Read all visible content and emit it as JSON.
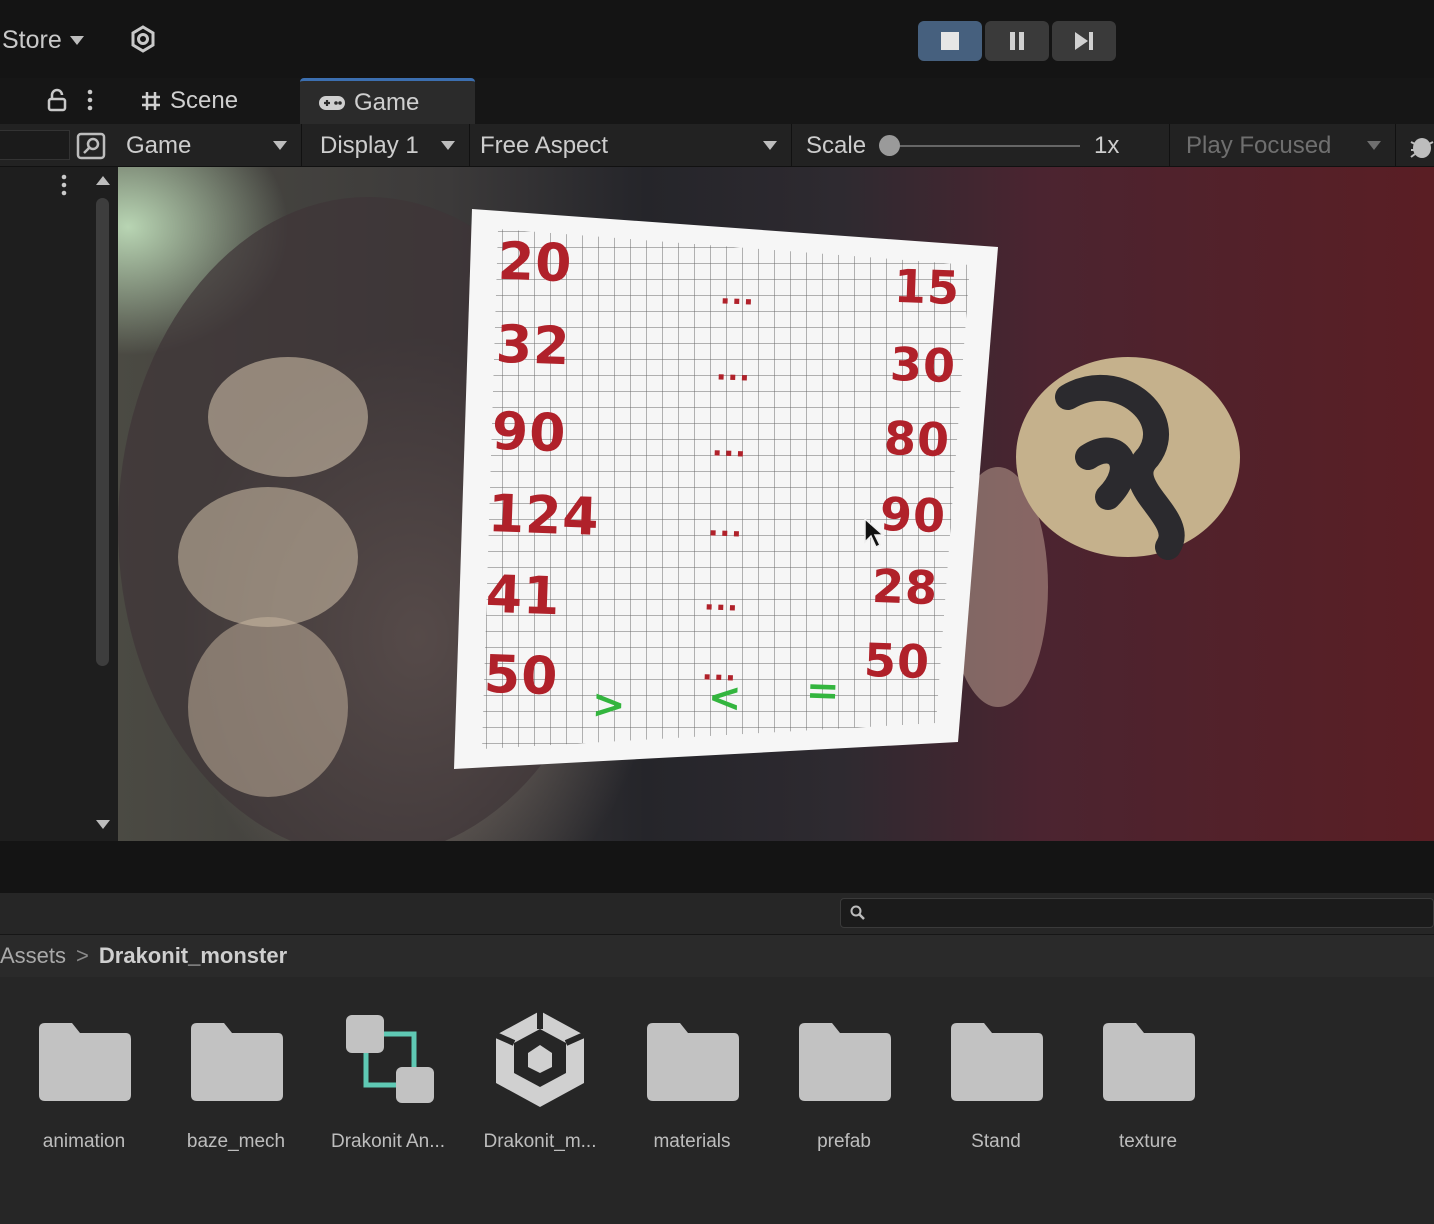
{
  "toolbar": {
    "store_label": "Store",
    "icons": [
      "settings-gear-icon",
      "stop-icon",
      "pause-icon",
      "step-icon"
    ],
    "play_active_color": "#46607e"
  },
  "tabs": [
    {
      "label": "Scene",
      "icon": "grid-hash-icon"
    },
    {
      "label": "Game",
      "icon": "gamepad-icon",
      "active": true
    }
  ],
  "game_toolbar": {
    "mode": "Game",
    "display": "Display 1",
    "aspect": "Free Aspect",
    "scale_label": "Scale",
    "scale_value": "1x",
    "play_mode": "Play Focused"
  },
  "card": {
    "left_numbers": [
      "20",
      "32",
      "90",
      "124",
      "41",
      "50"
    ],
    "dots": [
      "...",
      "...",
      "...",
      "...",
      "...",
      "..."
    ],
    "right_numbers": [
      "15",
      "30",
      "80",
      "90",
      "28",
      "50"
    ],
    "symbols": [
      ">",
      "<",
      "="
    ],
    "number_color": "#b0212a",
    "symbol_color": "#33b53e"
  },
  "breadcrumb": {
    "root": "Assets",
    "separator": ">",
    "current": "Drakonit_monster"
  },
  "assets": [
    {
      "label": "animation",
      "icon": "folder-icon"
    },
    {
      "label": "baze_mech",
      "icon": "folder-icon"
    },
    {
      "label": "Drakonit An...",
      "icon": "animator-controller-icon"
    },
    {
      "label": "Drakonit_m...",
      "icon": "prefab-cube-icon"
    },
    {
      "label": "materials",
      "icon": "folder-icon"
    },
    {
      "label": "prefab",
      "icon": "folder-icon"
    },
    {
      "label": "Stand",
      "icon": "folder-icon"
    },
    {
      "label": "texture",
      "icon": "folder-icon"
    }
  ]
}
